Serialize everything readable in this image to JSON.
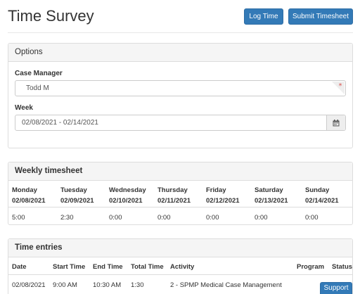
{
  "header": {
    "title": "Time Survey",
    "log_time_label": "Log Time",
    "submit_label": "Submit Timesheet"
  },
  "options": {
    "heading": "Options",
    "case_manager_label": "Case Manager",
    "case_manager_value": "Todd M",
    "week_label": "Week",
    "week_value": "02/08/2021 - 02/14/2021"
  },
  "weekly": {
    "heading": "Weekly timesheet",
    "days": [
      {
        "name": "Monday",
        "date": "02/08/2021",
        "value": "5:00"
      },
      {
        "name": "Tuesday",
        "date": "02/09/2021",
        "value": "2:30"
      },
      {
        "name": "Wednesday",
        "date": "02/10/2021",
        "value": "0:00"
      },
      {
        "name": "Thursday",
        "date": "02/11/2021",
        "value": "0:00"
      },
      {
        "name": "Friday",
        "date": "02/12/2021",
        "value": "0:00"
      },
      {
        "name": "Saturday",
        "date": "02/13/2021",
        "value": "0:00"
      },
      {
        "name": "Sunday",
        "date": "02/14/2021",
        "value": "0:00"
      }
    ]
  },
  "entries": {
    "heading": "Time entries",
    "columns": [
      "Date",
      "Start Time",
      "End Time",
      "Total Time",
      "Activity",
      "Program",
      "Status"
    ],
    "rows": [
      [
        "02/08/2021",
        "9:00 AM",
        "10:30 AM",
        "1:30",
        "2 - SPMP Medical Case Management",
        "",
        ""
      ]
    ]
  },
  "support_label": "Support",
  "colors": {
    "primary": "#337ab7",
    "required": "#d9534f"
  }
}
